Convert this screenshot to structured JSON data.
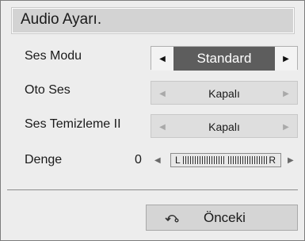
{
  "title": "Audio Ayarı.",
  "rows": [
    {
      "label": "Ses Modu",
      "value": "Standard"
    },
    {
      "label": "Oto Ses",
      "value": "Kapalı"
    },
    {
      "label": "Ses Temizleme II",
      "value": "Kapalı"
    }
  ],
  "balance": {
    "label": "Denge",
    "value": "0",
    "left_mark": "L",
    "right_mark": "R"
  },
  "arrows": {
    "left": "◀",
    "right": "▶"
  },
  "back_button": {
    "label": "Önceki",
    "icon": "return-icon"
  }
}
